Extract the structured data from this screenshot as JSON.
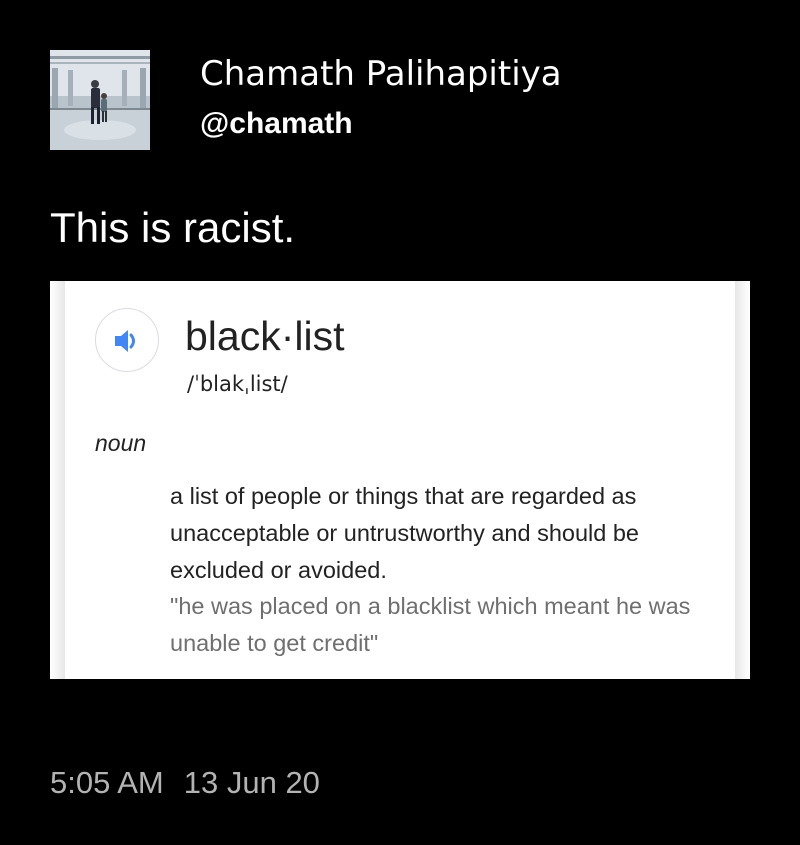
{
  "tweet": {
    "author": {
      "display_name": "Chamath Palihapitiya",
      "handle": "@chamath",
      "avatar_icon": "profile-photo"
    },
    "text": "This is racist.",
    "time": "5:05 AM",
    "date": "13 Jun 20"
  },
  "attached_image": {
    "word": "black·list",
    "phonetic": "/ˈblakˌlist/",
    "part_of_speech": "noun",
    "definition": "a list of people or things that are regarded as unacceptable or untrustworthy and should be excluded or avoided.",
    "example": "\"he was placed on a blacklist which meant he was unable to get credit\"",
    "speaker_icon": "volume-icon",
    "speaker_color": "#4285f4"
  },
  "colors": {
    "background": "#000000",
    "text_primary": "#ffffff",
    "text_secondary": "#b3b3b3"
  }
}
